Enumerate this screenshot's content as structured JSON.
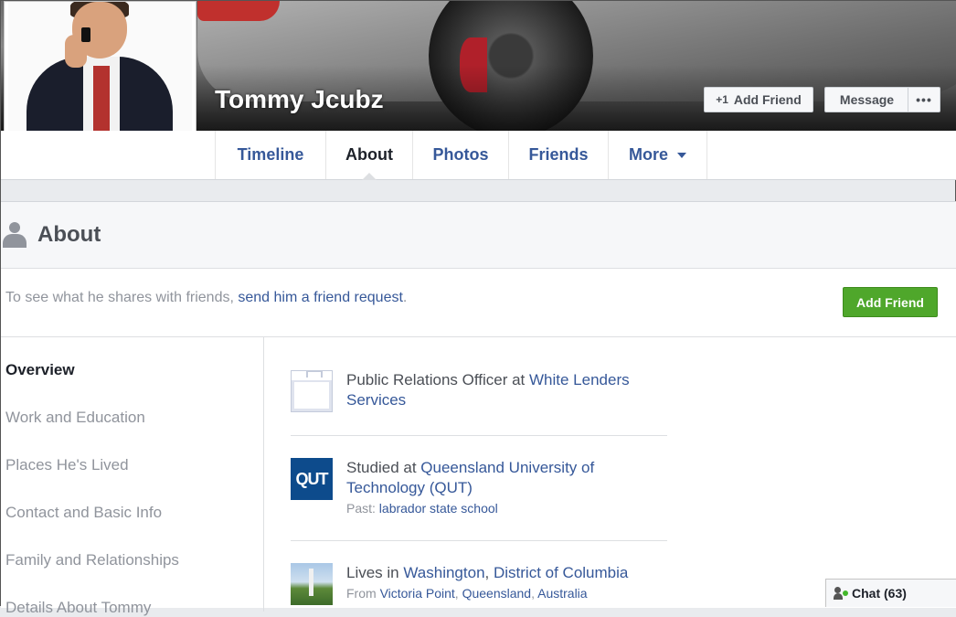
{
  "profile": {
    "name": "Tommy Jcubz"
  },
  "cover_actions": {
    "add_friend_label": "Add Friend",
    "message_label": "Message",
    "more_label": "•••"
  },
  "tabs": [
    {
      "label": "Timeline",
      "active": false
    },
    {
      "label": "About",
      "active": true
    },
    {
      "label": "Photos",
      "active": false
    },
    {
      "label": "Friends",
      "active": false
    },
    {
      "label": "More",
      "active": false
    }
  ],
  "about": {
    "title": "About",
    "notice_prefix": "To see what he shares with friends, ",
    "notice_link": "send him a friend request",
    "notice_suffix": ".",
    "add_friend_label": "Add Friend"
  },
  "leftnav": [
    {
      "label": "Overview",
      "active": true
    },
    {
      "label": "Work and Education",
      "active": false
    },
    {
      "label": "Places He's Lived",
      "active": false
    },
    {
      "label": "Contact and Basic Info",
      "active": false
    },
    {
      "label": "Family and Relationships",
      "active": false
    },
    {
      "label": "Details About Tommy",
      "active": false
    }
  ],
  "entries": {
    "work": {
      "prefix": "Public Relations Officer at ",
      "link": "White Lenders Services"
    },
    "education": {
      "icon_text": "QUT",
      "prefix": "Studied at ",
      "link": "Queensland University of Technology (QUT)",
      "sub_prefix": "Past: ",
      "sub_link": "labrador state school"
    },
    "place": {
      "prefix": "Lives in ",
      "link_city": "Washington",
      "sep": ", ",
      "link_region": "District of Columbia",
      "sub_prefix": "From ",
      "sub_link_a": "Victoria Point",
      "sub_sep1": ", ",
      "sub_link_b": "Queensland",
      "sub_sep2": ", ",
      "sub_link_c": "Australia"
    }
  },
  "chat": {
    "label": "Chat (63)"
  },
  "colors": {
    "link_blue": "#365899",
    "green_button": "#4fa72b",
    "muted_gray": "#90949c"
  }
}
